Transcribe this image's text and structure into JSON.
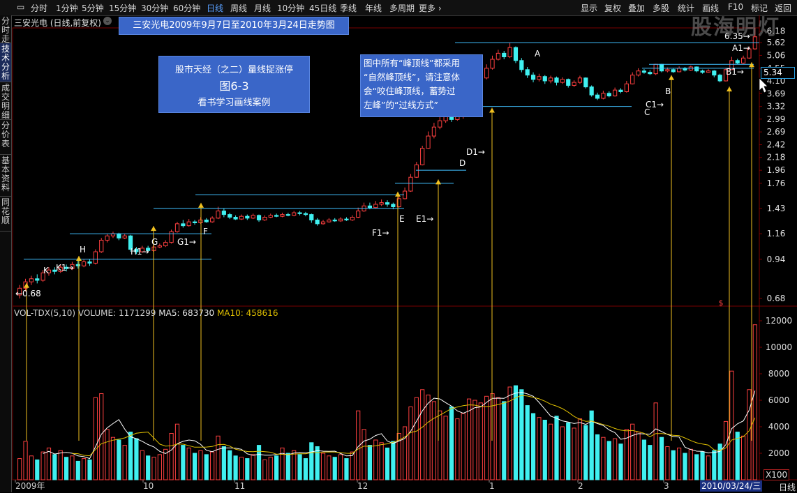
{
  "toolbar": {
    "left_items": [
      "分时",
      "1分钟",
      "5分钟",
      "15分钟",
      "30分钟",
      "60分钟",
      "日线",
      "周线",
      "月线",
      "10分钟",
      "45日线",
      "季线",
      "年线",
      "多周期",
      "更多 ›"
    ],
    "active": "日线",
    "right_items": [
      "显示",
      "复权",
      "叠加",
      "多股",
      "统计",
      "画线",
      "F10",
      "标记",
      "返回"
    ]
  },
  "sidebar": {
    "tabs": [
      "分时走势",
      "技术分析",
      "成交明细",
      "分价表",
      "基本资料",
      "同花顺"
    ],
    "active": "技术分析"
  },
  "stock_name": "三安光电 (日线,前复权)",
  "dropdown_glyph": "⌄",
  "title_box": "三安光电2009年9月7日至2010年3月24日走势图",
  "info_box": {
    "line1": "股市天经（之二）量线捉涨停",
    "line2": "图6-3",
    "line3": "看书学习画线案例"
  },
  "note_box": {
    "lines": [
      "图中所有“峰顶线”都采用",
      "“自然峰顶线”，请注意体",
      "会“咬住峰顶线，蓄势过",
      "左峰”的“过线方式”"
    ]
  },
  "watermark": "股海明灯",
  "current_price": "5.34",
  "price_axis": [
    "6.18",
    "5.62",
    "5.06",
    "4.55",
    "4.10",
    "3.69",
    "3.32",
    "2.99",
    "2.69",
    "2.42",
    "2.18",
    "1.96",
    "1.76",
    "1.43",
    "1.16",
    "0.94",
    "0.68"
  ],
  "low_marker": "←0.68",
  "top_marker": "6.35→",
  "volume_header": {
    "label": "VOL-TDX(5,10)",
    "volume": "VOLUME: 1171299",
    "ma5": "MA5: 683730",
    "ma10": "MA10: 458616"
  },
  "volume_axis": [
    "12000",
    "10000",
    "8000",
    "6000",
    "4000",
    "2000"
  ],
  "volume_unit": "X100",
  "x_axis": [
    "2009年",
    "10",
    "11",
    "12",
    "1",
    "2",
    "3"
  ],
  "date_box": "2010/03/24/三",
  "period_label": "日线",
  "dollar_marker": "$",
  "colors": {
    "up": "#ff4040",
    "down": "#40f0f0",
    "line": "#40c0ff",
    "arrow": "#f0c020",
    "ma5": "#ffffff",
    "ma10": "#e0c000",
    "grid": "#7a0000"
  },
  "chart_data": {
    "type": "candlestick",
    "title": "三安光电2009年9月7日至2010年3月24日走势图",
    "price_range": [
      0.68,
      6.35
    ],
    "volume_range": [
      0,
      12000
    ],
    "peak_labels": [
      {
        "label": "K",
        "price": 0.94
      },
      {
        "label": "K1→",
        "price": 0.94
      },
      {
        "label": "H",
        "price": 1.16
      },
      {
        "label": "H1→",
        "price": 1.2
      },
      {
        "label": "G",
        "price": 1.43
      },
      {
        "label": "G1→",
        "price": 1.43
      },
      {
        "label": "F",
        "price": 1.6
      },
      {
        "label": "F1→",
        "price": 1.76
      },
      {
        "label": "E",
        "price": 1.96
      },
      {
        "label": "E1→",
        "price": 1.96
      },
      {
        "label": "D",
        "price": 3.05
      },
      {
        "label": "D1→",
        "price": 3.6
      },
      {
        "label": "A",
        "price": 5.62
      },
      {
        "label": "C",
        "price": 4.4
      },
      {
        "label": "C1→",
        "price": 4.55
      },
      {
        "label": "B",
        "price": 4.7
      },
      {
        "label": "B1→",
        "price": 5.34
      },
      {
        "label": "A1→",
        "price": 5.9
      }
    ],
    "candles": [
      {
        "o": 0.7,
        "c": 0.74,
        "h": 0.76,
        "l": 0.68,
        "v": 1600
      },
      {
        "o": 0.74,
        "c": 0.78,
        "h": 0.8,
        "l": 0.72,
        "v": 2900
      },
      {
        "o": 0.78,
        "c": 0.8,
        "h": 0.82,
        "l": 0.76,
        "v": 1800
      },
      {
        "o": 0.8,
        "c": 0.79,
        "h": 0.83,
        "l": 0.77,
        "v": 1500
      },
      {
        "o": 0.79,
        "c": 0.84,
        "h": 0.86,
        "l": 0.78,
        "v": 2100
      },
      {
        "o": 0.84,
        "c": 0.86,
        "h": 0.88,
        "l": 0.82,
        "v": 2400
      },
      {
        "o": 0.86,
        "c": 0.85,
        "h": 0.88,
        "l": 0.83,
        "v": 1900
      },
      {
        "o": 0.85,
        "c": 0.88,
        "h": 0.9,
        "l": 0.84,
        "v": 2200
      },
      {
        "o": 0.88,
        "c": 0.87,
        "h": 0.9,
        "l": 0.85,
        "v": 1700
      },
      {
        "o": 0.87,
        "c": 0.9,
        "h": 0.92,
        "l": 0.86,
        "v": 1800
      },
      {
        "o": 0.9,
        "c": 0.89,
        "h": 0.93,
        "l": 0.87,
        "v": 1400
      },
      {
        "o": 0.89,
        "c": 0.92,
        "h": 0.94,
        "l": 0.88,
        "v": 1600
      },
      {
        "o": 0.92,
        "c": 0.91,
        "h": 0.94,
        "l": 0.89,
        "v": 1500
      },
      {
        "o": 0.91,
        "c": 1.0,
        "h": 1.02,
        "l": 0.9,
        "v": 6200
      },
      {
        "o": 1.0,
        "c": 1.1,
        "h": 1.12,
        "l": 0.99,
        "v": 6500
      },
      {
        "o": 1.1,
        "c": 1.14,
        "h": 1.16,
        "l": 1.08,
        "v": 3800
      },
      {
        "o": 1.14,
        "c": 1.16,
        "h": 1.18,
        "l": 1.12,
        "v": 3200
      },
      {
        "o": 1.16,
        "c": 1.12,
        "h": 1.17,
        "l": 1.1,
        "v": 3000
      },
      {
        "o": 1.12,
        "c": 1.14,
        "h": 1.16,
        "l": 1.11,
        "v": 2600
      },
      {
        "o": 1.14,
        "c": 1.02,
        "h": 1.15,
        "l": 1.0,
        "v": 3600
      },
      {
        "o": 1.02,
        "c": 1.0,
        "h": 1.04,
        "l": 0.98,
        "v": 3100
      },
      {
        "o": 1.0,
        "c": 1.03,
        "h": 1.05,
        "l": 0.99,
        "v": 2200
      },
      {
        "o": 1.03,
        "c": 1.01,
        "h": 1.05,
        "l": 1.0,
        "v": 1800
      },
      {
        "o": 1.01,
        "c": 1.04,
        "h": 1.06,
        "l": 1.0,
        "v": 1700
      },
      {
        "o": 1.04,
        "c": 1.05,
        "h": 1.07,
        "l": 1.03,
        "v": 1900
      },
      {
        "o": 1.05,
        "c": 1.08,
        "h": 1.1,
        "l": 1.04,
        "v": 2300
      },
      {
        "o": 1.08,
        "c": 1.18,
        "h": 1.2,
        "l": 1.07,
        "v": 3500
      },
      {
        "o": 1.18,
        "c": 1.26,
        "h": 1.28,
        "l": 1.17,
        "v": 4200
      },
      {
        "o": 1.26,
        "c": 1.24,
        "h": 1.3,
        "l": 1.22,
        "v": 2600
      },
      {
        "o": 1.24,
        "c": 1.28,
        "h": 1.31,
        "l": 1.23,
        "v": 2400
      },
      {
        "o": 1.28,
        "c": 1.27,
        "h": 1.3,
        "l": 1.25,
        "v": 2000
      },
      {
        "o": 1.27,
        "c": 1.3,
        "h": 1.33,
        "l": 1.26,
        "v": 2200
      },
      {
        "o": 1.3,
        "c": 1.28,
        "h": 1.32,
        "l": 1.27,
        "v": 1900
      },
      {
        "o": 1.28,
        "c": 1.32,
        "h": 1.34,
        "l": 1.27,
        "v": 2100
      },
      {
        "o": 1.32,
        "c": 1.4,
        "h": 1.45,
        "l": 1.31,
        "v": 3300
      },
      {
        "o": 1.4,
        "c": 1.36,
        "h": 1.43,
        "l": 1.33,
        "v": 2500
      },
      {
        "o": 1.36,
        "c": 1.33,
        "h": 1.38,
        "l": 1.31,
        "v": 2200
      },
      {
        "o": 1.33,
        "c": 1.31,
        "h": 1.35,
        "l": 1.3,
        "v": 1800
      },
      {
        "o": 1.31,
        "c": 1.34,
        "h": 1.36,
        "l": 1.3,
        "v": 1700
      },
      {
        "o": 1.34,
        "c": 1.32,
        "h": 1.36,
        "l": 1.3,
        "v": 1600
      },
      {
        "o": 1.32,
        "c": 1.35,
        "h": 1.37,
        "l": 1.31,
        "v": 1900
      },
      {
        "o": 1.35,
        "c": 1.3,
        "h": 1.36,
        "l": 1.28,
        "v": 2600
      },
      {
        "o": 1.3,
        "c": 1.33,
        "h": 1.35,
        "l": 1.29,
        "v": 1500
      },
      {
        "o": 1.33,
        "c": 1.35,
        "h": 1.37,
        "l": 1.32,
        "v": 1700
      },
      {
        "o": 1.35,
        "c": 1.34,
        "h": 1.37,
        "l": 1.33,
        "v": 1800
      },
      {
        "o": 1.34,
        "c": 1.36,
        "h": 1.38,
        "l": 1.33,
        "v": 2400
      },
      {
        "o": 1.36,
        "c": 1.35,
        "h": 1.38,
        "l": 1.34,
        "v": 2000
      },
      {
        "o": 1.35,
        "c": 1.38,
        "h": 1.4,
        "l": 1.34,
        "v": 2200
      },
      {
        "o": 1.38,
        "c": 1.37,
        "h": 1.4,
        "l": 1.35,
        "v": 1900
      },
      {
        "o": 1.37,
        "c": 1.36,
        "h": 1.39,
        "l": 1.34,
        "v": 1600
      },
      {
        "o": 1.36,
        "c": 1.3,
        "h": 1.37,
        "l": 1.27,
        "v": 2800
      },
      {
        "o": 1.3,
        "c": 1.26,
        "h": 1.32,
        "l": 1.24,
        "v": 2500
      },
      {
        "o": 1.26,
        "c": 1.28,
        "h": 1.3,
        "l": 1.25,
        "v": 2000
      },
      {
        "o": 1.28,
        "c": 1.3,
        "h": 1.32,
        "l": 1.27,
        "v": 1800
      },
      {
        "o": 1.3,
        "c": 1.29,
        "h": 1.32,
        "l": 1.28,
        "v": 1700
      },
      {
        "o": 1.29,
        "c": 1.31,
        "h": 1.33,
        "l": 1.28,
        "v": 1900
      },
      {
        "o": 1.31,
        "c": 1.3,
        "h": 1.33,
        "l": 1.29,
        "v": 1600
      },
      {
        "o": 1.3,
        "c": 1.33,
        "h": 1.35,
        "l": 1.29,
        "v": 2100
      },
      {
        "o": 1.33,
        "c": 1.4,
        "h": 1.44,
        "l": 1.32,
        "v": 5200
      },
      {
        "o": 1.4,
        "c": 1.46,
        "h": 1.5,
        "l": 1.39,
        "v": 3800
      },
      {
        "o": 1.46,
        "c": 1.44,
        "h": 1.5,
        "l": 1.42,
        "v": 2600
      },
      {
        "o": 1.44,
        "c": 1.48,
        "h": 1.52,
        "l": 1.43,
        "v": 3000
      },
      {
        "o": 1.48,
        "c": 1.5,
        "h": 1.54,
        "l": 1.46,
        "v": 2800
      },
      {
        "o": 1.5,
        "c": 1.48,
        "h": 1.53,
        "l": 1.45,
        "v": 2400
      },
      {
        "o": 1.48,
        "c": 1.45,
        "h": 1.5,
        "l": 1.42,
        "v": 2900
      },
      {
        "o": 1.45,
        "c": 1.55,
        "h": 1.6,
        "l": 1.44,
        "v": 3500
      },
      {
        "o": 1.55,
        "c": 1.65,
        "h": 1.7,
        "l": 1.54,
        "v": 4000
      },
      {
        "o": 1.65,
        "c": 1.85,
        "h": 1.9,
        "l": 1.64,
        "v": 5500
      },
      {
        "o": 1.85,
        "c": 2.05,
        "h": 2.1,
        "l": 1.84,
        "v": 6200
      },
      {
        "o": 2.05,
        "c": 2.35,
        "h": 2.4,
        "l": 2.04,
        "v": 6800
      },
      {
        "o": 2.35,
        "c": 2.6,
        "h": 2.7,
        "l": 2.34,
        "v": 6400
      },
      {
        "o": 2.6,
        "c": 2.8,
        "h": 2.9,
        "l": 2.55,
        "v": 5900
      },
      {
        "o": 2.8,
        "c": 2.95,
        "h": 3.05,
        "l": 2.75,
        "v": 5200
      },
      {
        "o": 2.95,
        "c": 3.1,
        "h": 3.2,
        "l": 2.9,
        "v": 4800
      },
      {
        "o": 3.1,
        "c": 2.98,
        "h": 3.15,
        "l": 2.92,
        "v": 5500
      },
      {
        "o": 2.98,
        "c": 3.05,
        "h": 3.12,
        "l": 2.95,
        "v": 4600
      },
      {
        "o": 3.05,
        "c": 3.3,
        "h": 3.4,
        "l": 3.0,
        "v": 5000
      },
      {
        "o": 3.3,
        "c": 3.6,
        "h": 3.7,
        "l": 3.25,
        "v": 6100
      },
      {
        "o": 3.6,
        "c": 3.9,
        "h": 4.0,
        "l": 3.55,
        "v": 6000
      },
      {
        "o": 3.9,
        "c": 4.2,
        "h": 4.3,
        "l": 3.85,
        "v": 5800
      },
      {
        "o": 4.2,
        "c": 4.55,
        "h": 4.7,
        "l": 4.15,
        "v": 6300
      },
      {
        "o": 4.55,
        "c": 4.9,
        "h": 5.05,
        "l": 4.5,
        "v": 6500
      },
      {
        "o": 4.9,
        "c": 5.15,
        "h": 5.3,
        "l": 4.85,
        "v": 6200
      },
      {
        "o": 5.15,
        "c": 5.0,
        "h": 5.25,
        "l": 4.9,
        "v": 5900
      },
      {
        "o": 5.0,
        "c": 5.4,
        "h": 5.62,
        "l": 4.95,
        "v": 7000
      },
      {
        "o": 5.4,
        "c": 4.85,
        "h": 5.45,
        "l": 4.75,
        "v": 7100
      },
      {
        "o": 4.85,
        "c": 4.5,
        "h": 4.95,
        "l": 4.4,
        "v": 6800
      },
      {
        "o": 4.5,
        "c": 4.3,
        "h": 4.6,
        "l": 4.2,
        "v": 5600
      },
      {
        "o": 4.3,
        "c": 4.15,
        "h": 4.4,
        "l": 4.05,
        "v": 5000
      },
      {
        "o": 4.15,
        "c": 4.25,
        "h": 4.35,
        "l": 4.08,
        "v": 4700
      },
      {
        "o": 4.25,
        "c": 4.1,
        "h": 4.3,
        "l": 4.0,
        "v": 4500
      },
      {
        "o": 4.1,
        "c": 4.2,
        "h": 4.28,
        "l": 4.02,
        "v": 4200
      },
      {
        "o": 4.2,
        "c": 4.05,
        "h": 4.25,
        "l": 3.95,
        "v": 4800
      },
      {
        "o": 4.05,
        "c": 4.15,
        "h": 4.22,
        "l": 4.0,
        "v": 4000
      },
      {
        "o": 4.15,
        "c": 3.95,
        "h": 4.18,
        "l": 3.88,
        "v": 4300
      },
      {
        "o": 3.95,
        "c": 4.05,
        "h": 4.12,
        "l": 3.9,
        "v": 3900
      },
      {
        "o": 4.05,
        "c": 4.2,
        "h": 4.28,
        "l": 4.0,
        "v": 4600
      },
      {
        "o": 4.2,
        "c": 3.9,
        "h": 4.22,
        "l": 3.85,
        "v": 4100
      },
      {
        "o": 3.9,
        "c": 3.65,
        "h": 3.95,
        "l": 3.6,
        "v": 5200
      },
      {
        "o": 3.65,
        "c": 3.55,
        "h": 3.72,
        "l": 3.5,
        "v": 3400
      },
      {
        "o": 3.55,
        "c": 3.7,
        "h": 3.78,
        "l": 3.52,
        "v": 3200
      },
      {
        "o": 3.7,
        "c": 3.62,
        "h": 3.76,
        "l": 3.58,
        "v": 2900
      },
      {
        "o": 3.62,
        "c": 3.8,
        "h": 3.88,
        "l": 3.6,
        "v": 3100
      },
      {
        "o": 3.8,
        "c": 3.75,
        "h": 3.86,
        "l": 3.7,
        "v": 2700
      },
      {
        "o": 3.75,
        "c": 4.0,
        "h": 4.1,
        "l": 3.72,
        "v": 3800
      },
      {
        "o": 4.0,
        "c": 4.3,
        "h": 4.4,
        "l": 3.98,
        "v": 4200
      },
      {
        "o": 4.3,
        "c": 4.45,
        "h": 4.55,
        "l": 4.25,
        "v": 3600
      },
      {
        "o": 4.45,
        "c": 4.4,
        "h": 4.52,
        "l": 4.35,
        "v": 3000
      },
      {
        "o": 4.4,
        "c": 4.35,
        "h": 4.48,
        "l": 4.3,
        "v": 2600
      },
      {
        "o": 4.35,
        "c": 4.7,
        "h": 4.72,
        "l": 4.3,
        "v": 5800
      },
      {
        "o": 4.7,
        "c": 4.45,
        "h": 4.72,
        "l": 4.4,
        "v": 3200
      },
      {
        "o": 4.45,
        "c": 4.5,
        "h": 4.58,
        "l": 4.4,
        "v": 2500
      },
      {
        "o": 4.5,
        "c": 4.42,
        "h": 4.56,
        "l": 4.38,
        "v": 2200
      },
      {
        "o": 4.42,
        "c": 4.55,
        "h": 4.62,
        "l": 4.4,
        "v": 2400
      },
      {
        "o": 4.55,
        "c": 4.48,
        "h": 4.6,
        "l": 4.43,
        "v": 2000
      },
      {
        "o": 4.48,
        "c": 4.6,
        "h": 4.65,
        "l": 4.45,
        "v": 2300
      },
      {
        "o": 4.6,
        "c": 4.45,
        "h": 4.62,
        "l": 4.4,
        "v": 1900
      },
      {
        "o": 4.45,
        "c": 4.4,
        "h": 4.5,
        "l": 4.35,
        "v": 2100
      },
      {
        "o": 4.4,
        "c": 4.45,
        "h": 4.52,
        "l": 4.38,
        "v": 1800
      },
      {
        "o": 4.45,
        "c": 4.3,
        "h": 4.48,
        "l": 4.22,
        "v": 2200
      },
      {
        "o": 4.3,
        "c": 4.1,
        "h": 4.35,
        "l": 4.05,
        "v": 2700
      },
      {
        "o": 4.1,
        "c": 4.5,
        "h": 4.55,
        "l": 4.08,
        "v": 4400
      },
      {
        "o": 4.5,
        "c": 4.85,
        "h": 5.0,
        "l": 4.48,
        "v": 8200
      },
      {
        "o": 4.85,
        "c": 4.75,
        "h": 4.92,
        "l": 4.7,
        "v": 3600
      },
      {
        "o": 4.75,
        "c": 4.95,
        "h": 5.05,
        "l": 4.72,
        "v": 3300
      },
      {
        "o": 4.95,
        "c": 5.34,
        "h": 5.45,
        "l": 4.92,
        "v": 6800
      },
      {
        "o": 5.34,
        "c": 5.9,
        "h": 6.35,
        "l": 5.3,
        "v": 11700
      }
    ]
  }
}
